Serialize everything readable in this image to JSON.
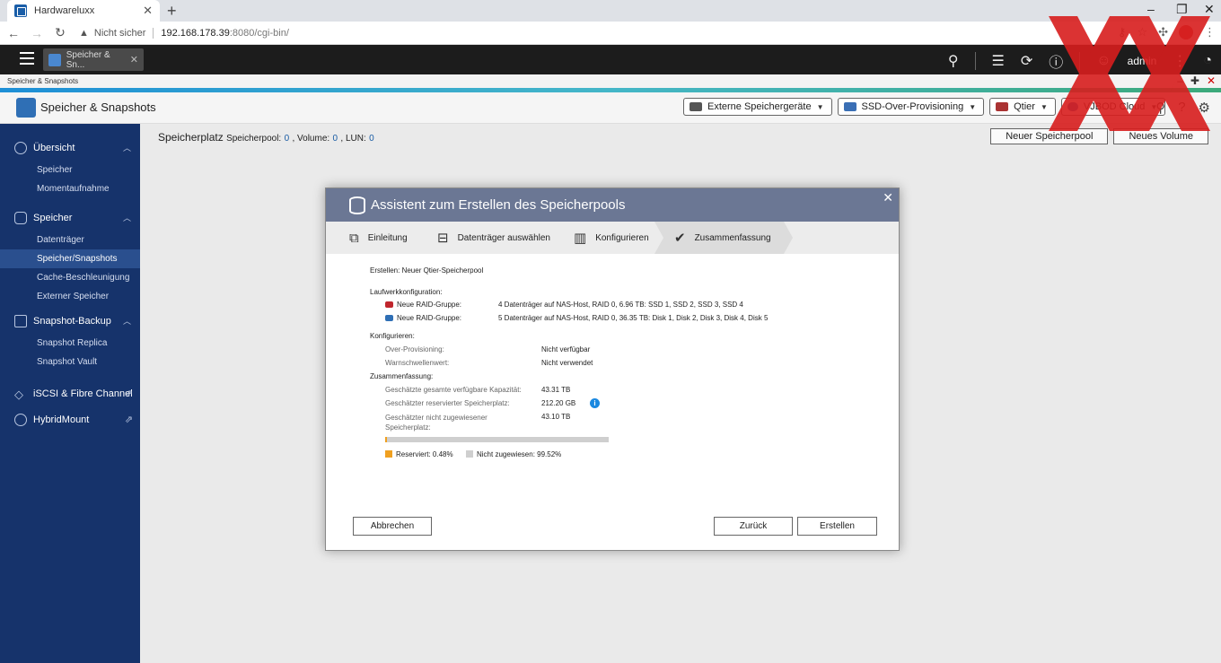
{
  "browser": {
    "tab_title": "Hardwareluxx",
    "tab_close": "✕",
    "new_tab": "+",
    "not_secure": "Nicht sicher",
    "url_host": "192.168.178.39",
    "url_path": ":8080/cgi-bin/"
  },
  "topbar": {
    "app_tab": "Speicher & Sn...",
    "app_tab_close": "✕",
    "user": "admin"
  },
  "window": {
    "title": "Speicher & Snapshots"
  },
  "header": {
    "title": "Speicher & Snapshots",
    "buttons": [
      {
        "label": "Externe Speichergeräte"
      },
      {
        "label": "SSD-Over-Provisioning"
      },
      {
        "label": "Qtier"
      },
      {
        "label": "VJBOD Cloud"
      }
    ]
  },
  "sidebar": {
    "groups": [
      {
        "label": "Übersicht",
        "items": [
          "Speicher",
          "Momentaufnahme"
        ]
      },
      {
        "label": "Speicher",
        "items": [
          "Datenträger",
          "Speicher/Snapshots",
          "Cache-Beschleunigung",
          "Externer Speicher"
        ]
      },
      {
        "label": "Snapshot-Backup",
        "items": [
          "Snapshot Replica",
          "Snapshot Vault"
        ]
      },
      {
        "label": "iSCSI & Fibre Channel"
      },
      {
        "label": "HybridMount"
      }
    ]
  },
  "main": {
    "title": "Speicherplatz",
    "pool_label": "Speicherpool:",
    "pool_count": "0",
    "volume_label": ", Volume:",
    "volume_count": "0",
    "lun_label": ", LUN:",
    "lun_count": "0",
    "new_pool_button": "Neuer Speicherpool",
    "new_volume_button": "Neues Volume"
  },
  "modal": {
    "title": "Assistent zum Erstellen des Speicherpools",
    "close": "✕",
    "steps": [
      "Einleitung",
      "Datenträger auswählen",
      "Konfigurieren",
      "Zusammenfassung"
    ],
    "create_line": "Erstellen: Neuer Qtier-Speicherpool",
    "drive_config_title": "Laufwerkkonfiguration:",
    "raid_groups": [
      {
        "label": "Neue RAID-Gruppe:",
        "value": "4 Datenträger auf NAS-Host, RAID 0, 6.96 TB: SSD 1, SSD 2, SSD 3, SSD 4",
        "color": "#c0262d"
      },
      {
        "label": "Neue RAID-Gruppe:",
        "value": "5 Datenträger auf NAS-Host, RAID 0, 36.35 TB: Disk 1, Disk 2, Disk 3, Disk 4, Disk 5",
        "color": "#2f6fb5"
      }
    ],
    "configure_title": "Konfigurieren:",
    "over_provisioning_label": "Over-Provisioning:",
    "over_provisioning_value": "Nicht verfügbar",
    "threshold_label": "Warnschwellenwert:",
    "threshold_value": "Nicht verwendet",
    "summary_title": "Zusammenfassung:",
    "capacity_label": "Geschätzte gesamte verfügbare Kapazität:",
    "capacity_value": "43.31 TB",
    "reserved_label": "Geschätzter reservierter Speicherplatz:",
    "reserved_value": "212.20 GB",
    "unassigned_label": "Geschätzter nicht zugewiesener Speicherplatz:",
    "unassigned_value": "43.10 TB",
    "reserved_fraction": 0.0048,
    "legend_reserved": "Reserviert: 0.48%",
    "legend_unassigned": "Nicht zugewiesen: 99.52%",
    "cancel_button": "Abbrechen",
    "back_button": "Zurück",
    "create_button": "Erstellen"
  },
  "colors": {
    "sidebar_bg": "#16336b",
    "modal_header": "#6b7794",
    "reserved": "#f0a020",
    "unassigned": "#cfcfcf",
    "watermark": "#d81e1e"
  }
}
